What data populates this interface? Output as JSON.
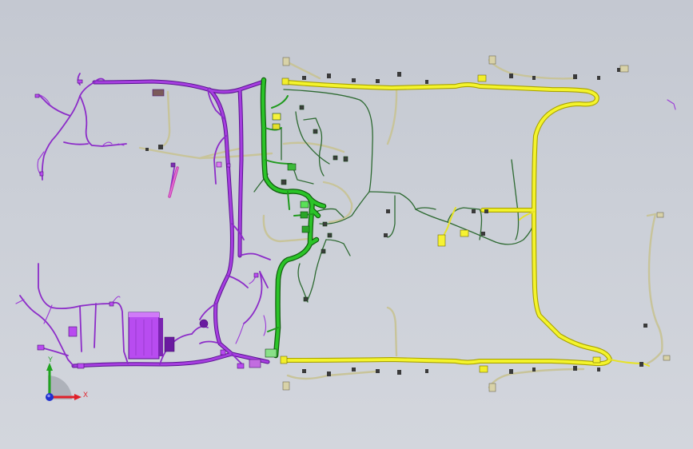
{
  "viewport": {
    "background_top": "#c4c8d1",
    "background_bottom": "#d3d6dd"
  },
  "harness_colors": {
    "purple": "#9b2fd6",
    "purple_dark": "#6a1aa0",
    "green": "#22b51f",
    "green_dark": "#166b1a",
    "yellow": "#f2f22a",
    "yellow_dark": "#b8b800",
    "tan": "#c8c49a",
    "wire_dark": "#3c4a3c"
  },
  "triad": {
    "x_label": "X",
    "y_label": "Y",
    "x_color": "#e0202a",
    "y_color": "#1fa31f",
    "z_color": "#2030d0"
  }
}
